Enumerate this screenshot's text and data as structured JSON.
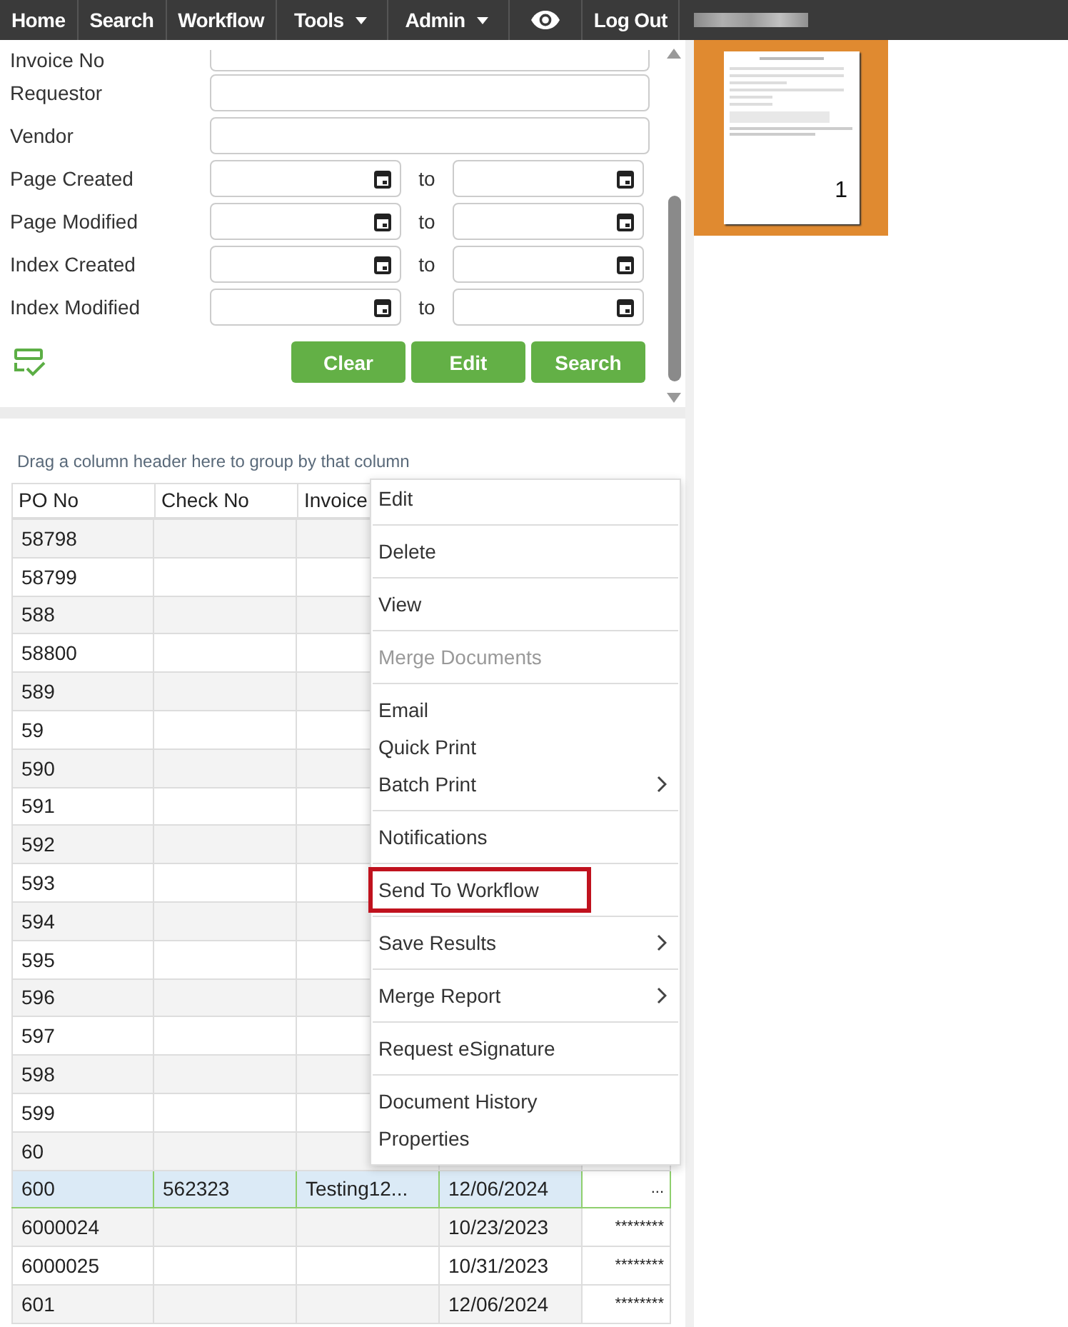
{
  "nav": {
    "items": [
      {
        "label": "Home",
        "dropdown": false
      },
      {
        "label": "Search",
        "dropdown": false
      },
      {
        "label": "Workflow",
        "dropdown": false
      },
      {
        "label": "Tools",
        "dropdown": true
      },
      {
        "label": "Admin",
        "dropdown": true
      }
    ],
    "logout": "Log Out"
  },
  "form": {
    "fields": [
      {
        "label": "Invoice No",
        "kind": "text"
      },
      {
        "label": "Requestor",
        "kind": "text"
      },
      {
        "label": "Vendor",
        "kind": "text"
      },
      {
        "label": "Page Created",
        "kind": "range",
        "to": "to"
      },
      {
        "label": "Page Modified",
        "kind": "range",
        "to": "to"
      },
      {
        "label": "Index Created",
        "kind": "range",
        "to": "to"
      },
      {
        "label": "Index Modified",
        "kind": "range",
        "to": "to"
      }
    ],
    "buttons": [
      "Clear",
      "Edit",
      "Search"
    ]
  },
  "grid": {
    "group_hint": "Drag a column header here to group by that column",
    "columns": [
      "PO No",
      "Check No",
      "Invoice"
    ],
    "rows": [
      {
        "cells": [
          "58798",
          "",
          "",
          "",
          ""
        ],
        "selected": false
      },
      {
        "cells": [
          "58799",
          "",
          "",
          "",
          ""
        ],
        "selected": false
      },
      {
        "cells": [
          "588",
          "",
          "",
          "",
          ""
        ],
        "selected": false
      },
      {
        "cells": [
          "58800",
          "",
          "",
          "",
          ""
        ],
        "selected": false
      },
      {
        "cells": [
          "589",
          "",
          "",
          "",
          ""
        ],
        "selected": false
      },
      {
        "cells": [
          "59",
          "",
          "",
          "",
          ""
        ],
        "selected": false
      },
      {
        "cells": [
          "590",
          "",
          "",
          "",
          ""
        ],
        "selected": false
      },
      {
        "cells": [
          "591",
          "",
          "",
          "",
          ""
        ],
        "selected": false
      },
      {
        "cells": [
          "592",
          "",
          "",
          "",
          ""
        ],
        "selected": false
      },
      {
        "cells": [
          "593",
          "",
          "",
          "",
          ""
        ],
        "selected": false
      },
      {
        "cells": [
          "594",
          "",
          "",
          "",
          ""
        ],
        "selected": false
      },
      {
        "cells": [
          "595",
          "",
          "",
          "",
          ""
        ],
        "selected": false
      },
      {
        "cells": [
          "596",
          "",
          "",
          "",
          ""
        ],
        "selected": false
      },
      {
        "cells": [
          "597",
          "",
          "",
          "",
          ""
        ],
        "selected": false
      },
      {
        "cells": [
          "598",
          "",
          "",
          "",
          ""
        ],
        "selected": false
      },
      {
        "cells": [
          "599",
          "",
          "",
          "",
          ""
        ],
        "selected": false
      },
      {
        "cells": [
          "60",
          "",
          "",
          "",
          ""
        ],
        "selected": false
      },
      {
        "cells": [
          "600",
          "562323",
          "Testing12...",
          "12/06/2024",
          "..."
        ],
        "selected": true
      },
      {
        "cells": [
          "6000024",
          "",
          "",
          "10/23/2023",
          "********"
        ],
        "selected": false
      },
      {
        "cells": [
          "6000025",
          "",
          "",
          "10/31/2023",
          "********"
        ],
        "selected": false
      },
      {
        "cells": [
          "601",
          "",
          "",
          "12/06/2024",
          "********"
        ],
        "selected": false
      }
    ]
  },
  "context_menu": {
    "groups": [
      [
        {
          "label": "Edit",
          "disabled": false,
          "submenu": false,
          "highlighted": false
        }
      ],
      [
        {
          "label": "Delete",
          "disabled": false,
          "submenu": false,
          "highlighted": false
        }
      ],
      [
        {
          "label": "View",
          "disabled": false,
          "submenu": false,
          "highlighted": false
        }
      ],
      [
        {
          "label": "Merge Documents",
          "disabled": true,
          "submenu": false,
          "highlighted": false
        }
      ],
      [
        {
          "label": "Email",
          "disabled": false,
          "submenu": false,
          "highlighted": false
        },
        {
          "label": "Quick Print",
          "disabled": false,
          "submenu": false,
          "highlighted": false
        },
        {
          "label": "Batch Print",
          "disabled": false,
          "submenu": true,
          "highlighted": false
        }
      ],
      [
        {
          "label": "Notifications",
          "disabled": false,
          "submenu": false,
          "highlighted": false
        }
      ],
      [
        {
          "label": "Send To Workflow",
          "disabled": false,
          "submenu": false,
          "highlighted": true
        }
      ],
      [
        {
          "label": "Save Results",
          "disabled": false,
          "submenu": true,
          "highlighted": false
        }
      ],
      [
        {
          "label": "Merge Report",
          "disabled": false,
          "submenu": true,
          "highlighted": false
        }
      ],
      [
        {
          "label": "Request eSignature",
          "disabled": false,
          "submenu": false,
          "highlighted": false
        }
      ],
      [
        {
          "label": "Document History",
          "disabled": false,
          "submenu": false,
          "highlighted": false
        },
        {
          "label": "Properties",
          "disabled": false,
          "submenu": false,
          "highlighted": false
        }
      ]
    ]
  },
  "thumbnails": [
    {
      "page": "1",
      "selected": true
    }
  ]
}
